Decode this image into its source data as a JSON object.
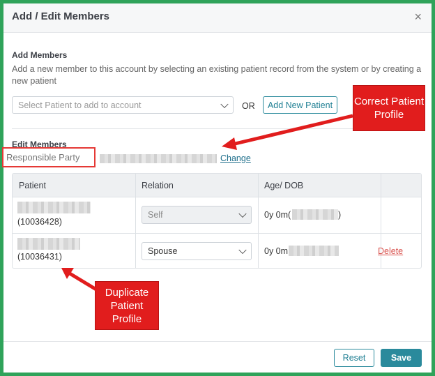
{
  "modal": {
    "title": "Add / Edit Members",
    "close": "×"
  },
  "add_members": {
    "heading": "Add Members",
    "description": "Add a new member to this account by selecting an existing patient record from the system or by creating a new patient",
    "select_placeholder": "Select Patient to add to account",
    "or_text": "OR",
    "add_new_label": "Add New Patient"
  },
  "edit_members": {
    "heading": "Edit Members",
    "responsible_party_label": "Responsible Party",
    "change_label": "Change"
  },
  "table": {
    "headers": [
      "Patient",
      "Relation",
      "Age/ DOB",
      ""
    ],
    "rows": [
      {
        "patient_id": "(10036428)",
        "relation": "Self",
        "age": "0y 0m(",
        "age_suffix": ")",
        "action": ""
      },
      {
        "patient_id": "(10036431)",
        "relation": "Spouse",
        "age": "0y 0m",
        "age_suffix": "",
        "action": "Delete"
      }
    ]
  },
  "footer": {
    "reset_label": "Reset",
    "save_label": "Save"
  },
  "annotations": {
    "correct_profile": "Correct Patient Profile",
    "duplicate_profile": "Duplicate Patient Profile"
  },
  "colors": {
    "frame": "#2fa35a",
    "accent": "#2a8a9c",
    "annotation": "#e11d1d",
    "delete": "#d9534f"
  }
}
